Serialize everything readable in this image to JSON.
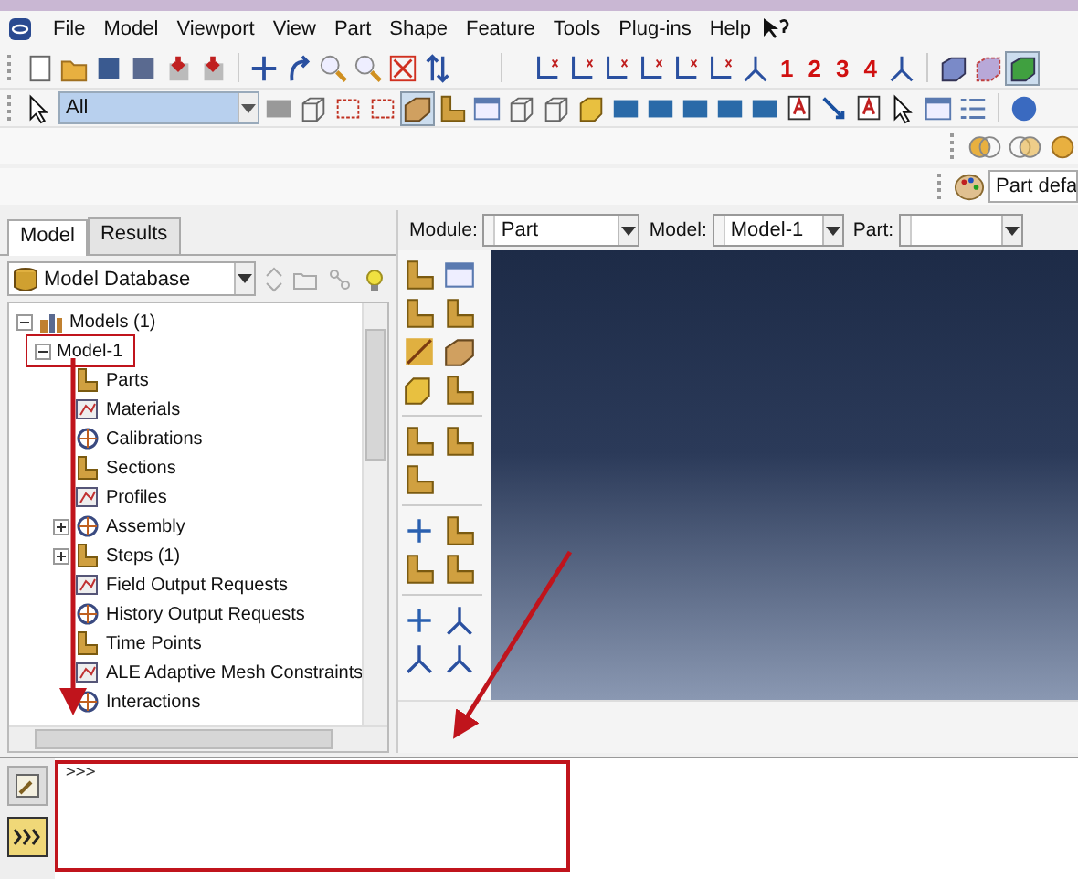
{
  "menu": [
    {
      "label": "File"
    },
    {
      "label": "Model"
    },
    {
      "label": "Viewport"
    },
    {
      "label": "View"
    },
    {
      "label": "Part"
    },
    {
      "label": "Shape"
    },
    {
      "label": "Feature"
    },
    {
      "label": "Tools"
    },
    {
      "label": "Plug-ins"
    },
    {
      "label": "Help"
    }
  ],
  "view_numbers": [
    "1",
    "2",
    "3",
    "4"
  ],
  "selection_filter": "All",
  "part_display": "Part defa",
  "tabs": [
    {
      "label": "Model",
      "selected": true
    },
    {
      "label": "Results",
      "selected": false
    }
  ],
  "database_combo": "Model Database",
  "tree": [
    {
      "label": "Models (1)",
      "collapsed": false,
      "children": [
        {
          "label": "Model-1",
          "collapsed": false,
          "annotated": true,
          "children": [
            {
              "label": "Parts",
              "collapsed": false
            },
            {
              "label": "Materials",
              "collapsed": false
            },
            {
              "label": "Calibrations",
              "collapsed": false
            },
            {
              "label": "Sections",
              "collapsed": false
            },
            {
              "label": "Profiles",
              "collapsed": false
            },
            {
              "label": "Assembly",
              "collapsed": true
            },
            {
              "label": "Steps (1)",
              "collapsed": true
            },
            {
              "label": "Field Output Requests",
              "collapsed": false
            },
            {
              "label": "History Output Requests",
              "collapsed": false
            },
            {
              "label": "Time Points",
              "collapsed": false
            },
            {
              "label": "ALE Adaptive Mesh Constraints",
              "collapsed": false
            },
            {
              "label": "Interactions",
              "collapsed": false
            }
          ]
        }
      ]
    }
  ],
  "context_bar": [
    {
      "label": "Module:",
      "value": "Part"
    },
    {
      "label": "Model:",
      "value": "Model-1"
    },
    {
      "label": "Part:"
    }
  ],
  "command": {
    "prompt": ">>>",
    "annotated": true
  }
}
